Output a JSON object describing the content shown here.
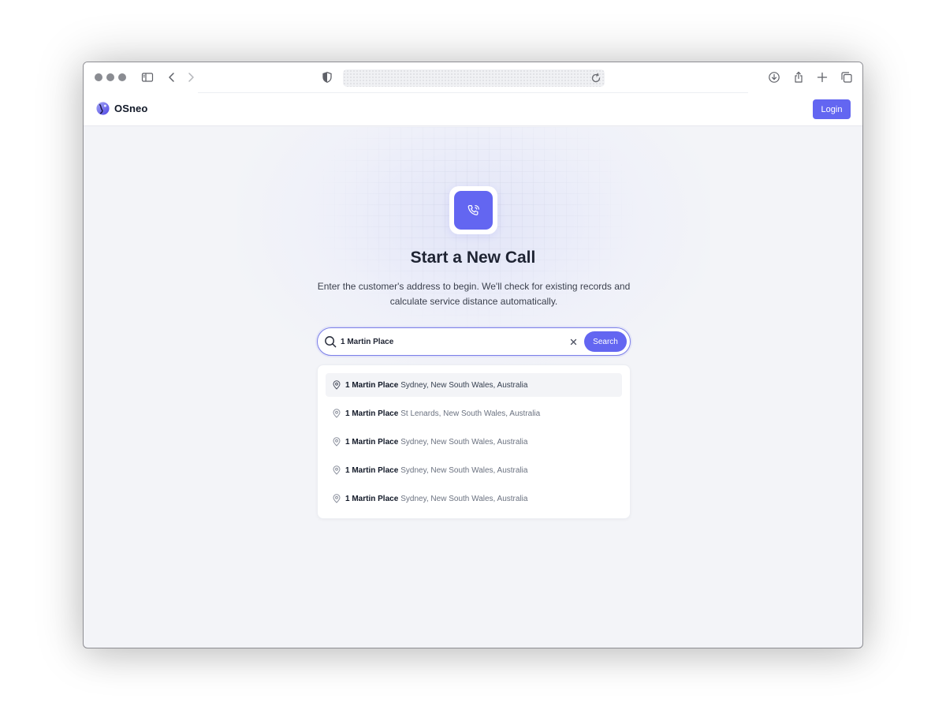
{
  "browser": {
    "icons": [
      "sidebar-icon",
      "back-icon",
      "forward-icon",
      "shield-icon",
      "reload-icon",
      "download-icon",
      "share-icon",
      "new-tab-icon",
      "tabs-overview-icon"
    ]
  },
  "nav": {
    "brand": "OSneo",
    "login_label": "Login"
  },
  "hero": {
    "icon": "phone-call-icon",
    "title": "Start a New Call",
    "subtitle": "Enter the customer's address to begin. We'll check for existing records and calculate service distance automatically."
  },
  "search": {
    "value": "1 Martin Place",
    "button_label": "Search"
  },
  "results": [
    {
      "main": "1 Martin Place",
      "secondary": "Sydney, New South Wales, Australia",
      "highlighted": true
    },
    {
      "main": "1 Martin Place",
      "secondary": "St Lenards, New South Wales, Australia",
      "highlighted": false
    },
    {
      "main": "1 Martin Place",
      "secondary": "Sydney, New South Wales, Australia",
      "highlighted": false
    },
    {
      "main": "1 Martin Place",
      "secondary": "Sydney, New South Wales, Australia",
      "highlighted": false
    },
    {
      "main": "1 Martin Place",
      "secondary": "Sydney, New South Wales, Australia",
      "highlighted": false
    }
  ],
  "colors": {
    "accent": "#6366f1",
    "page_bg": "#f3f4f8",
    "text_dark": "#1f2433",
    "text_muted": "#6b7280"
  }
}
